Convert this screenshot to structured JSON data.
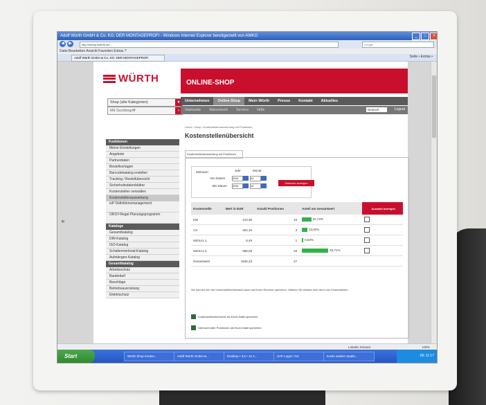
{
  "window": {
    "title": "Adolf Würth GmbH & Co. KG: DER MONTAGEPROFI - Windows Internet Explorer bereitgestellt von AWKG",
    "url": "http://eshop.wuerth.de/...",
    "search_placeholder": "Google",
    "menu": "Datei  Bearbeiten  Ansicht  Favoriten  Extras  ?",
    "tab": "Adolf Würth GmbH & Co. KG: DER MONTAGEPROFI",
    "tools": "Seite • Extras •"
  },
  "header": {
    "logo": "WÜRTH",
    "shop_title": "ONLINE-SHOP",
    "category_select": "Shop (alle Kategorien)",
    "quick_search": "Mit Suchbegriff",
    "nav_main": [
      "Unternehmen",
      "Online-Shop",
      "Mein Würth",
      "Presse",
      "Kontakt",
      "Aktuelles"
    ],
    "nav_sub": [
      "Startseite",
      "Warenkorb",
      "Service",
      "Hilfe"
    ],
    "language": "Deutsch",
    "logout": "Logout"
  },
  "sidebar": {
    "section1": "Funktionen",
    "items1": [
      "Meine Einstellungen",
      "Angebote",
      "Partnerdaten",
      "Bestellvorlagen",
      "Barcodekatalog erstellen",
      "Tracking / Bestellübersicht",
      "Sicherheitsdatenblätter",
      "Kostenstellen verwalten",
      "Kostenstellenauswertung",
      "ioP Definitionsmanagement",
      "ORSY-Regal Planungsprogramm"
    ],
    "section2": "Kataloge",
    "items2": [
      "Gesamtkatalog",
      "DIN-Katalog",
      "ISO-Katalog",
      "Schaltermerkmal-Katalog",
      "Aufstängen-Katalog"
    ],
    "section3": "Gesamtkatalog",
    "items3": [
      "Arbeitsschutz",
      "Baubedarf",
      "Beschläge",
      "Betriebsausrüstung",
      "Elektrischutz"
    ]
  },
  "main": {
    "breadcrumb": "Home / Shop / Kostenstellenauswertung mit Positionen",
    "heading": "Kostenstellenübersicht",
    "sub_tab": "Kostenstellenauswertung mit Positionen",
    "period_label": "Zeitraum",
    "year_label": "Jahr",
    "month_label": "Monat",
    "from_label": "Von Datum",
    "to_label": "Bis Datum",
    "from_year": "2011",
    "from_month": "01",
    "to_year": "2011",
    "to_month": "12",
    "apply_button": "Zeitraum anzeigen",
    "table": {
      "headers": [
        "Kostenstelle",
        "Wert in EUR",
        "Anzahl Positionen",
        "Anteil am Gesamtwert",
        "Auswahl anzeigen"
      ],
      "rows": [
        {
          "name": "EW",
          "value": "443,38",
          "count": "10",
          "share": "22,72%",
          "pct": 22.72
        },
        {
          "name": "CX",
          "value": "254,16",
          "count": "3",
          "share": "13,02%",
          "pct": 13.02
        },
        {
          "name": "MGSA1.1",
          "value": "8,49",
          "count": "1",
          "share": "0,62%",
          "pct": 0.62
        },
        {
          "name": "MGSA1.0",
          "value": "968,08",
          "count": "33",
          "share": "63,71%",
          "pct": 63.71
        }
      ],
      "total_label": "Gesamtwert",
      "total_value": "1945,33",
      "total_count": "47"
    },
    "notes": "Sie können hier die Kostenstellenübersicht auch auf Ihrem Rechner speichern. Wählen Sie einfach über dem Link Kostenstellen...",
    "xls1": "Kostenstellenübersicht als Excel-Datei speichern",
    "xls2": "Übersicht aller Positionen als Excel-Datei speichern"
  },
  "statusbar": {
    "zone": "Lokales Intranet",
    "zoom": "100%"
  },
  "taskbar": {
    "start": "Start",
    "items": [
      "Würth Shop Kosten...",
      "Adolf Würth GmbH &...",
      "Desktop • 3,5 • 12 A...",
      "SAP Logon 710",
      "Konfo andern Spalte..."
    ],
    "tray": "DE 11:17"
  }
}
